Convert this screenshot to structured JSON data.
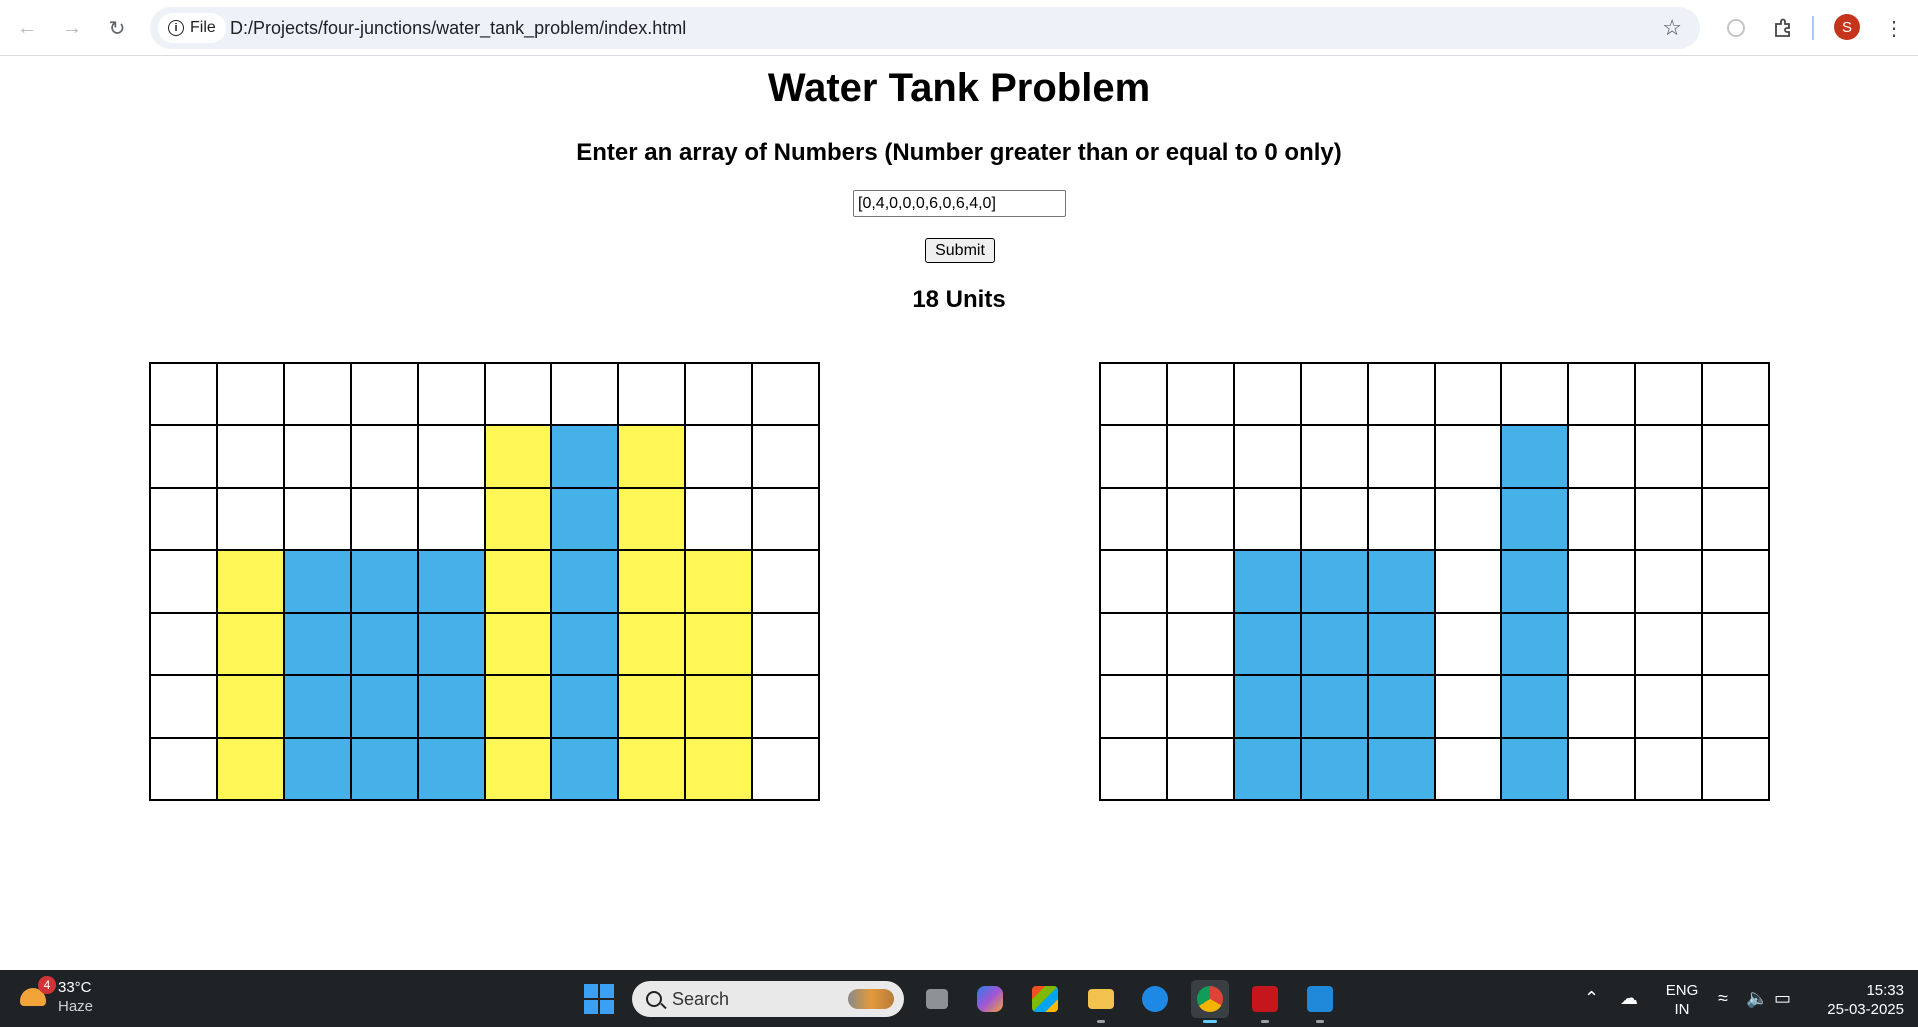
{
  "browser": {
    "site_chip": "File",
    "url": "D:/Projects/four-junctions/water_tank_problem/index.html",
    "profile_initial": "S"
  },
  "page": {
    "title": "Water Tank Problem",
    "prompt": "Enter an array of Numbers (Number greater than or equal to 0 only)",
    "input_value": "[0,4,0,0,0,6,0,6,4,0]",
    "submit_label": "Submit",
    "result": "18 Units"
  },
  "visualization": {
    "rows": 7,
    "cols": 10,
    "colors": {
      "block": "#fff755",
      "water": "#46b0e8",
      "empty": "#ffffff",
      "border": "#000000"
    },
    "left_grid": {
      "block_heights": [
        0,
        4,
        0,
        0,
        0,
        6,
        0,
        6,
        4,
        0
      ],
      "water_heights": [
        0,
        0,
        4,
        4,
        4,
        0,
        6,
        0,
        0,
        0
      ]
    },
    "right_grid": {
      "water_heights": [
        0,
        0,
        4,
        4,
        4,
        0,
        6,
        0,
        0,
        0
      ]
    }
  },
  "taskbar": {
    "weather_badge": "4",
    "temperature": "33°C",
    "condition": "Haze",
    "search_placeholder": "Search",
    "language": "ENG",
    "region": "IN",
    "time": "15:33",
    "date": "25-03-2025"
  }
}
